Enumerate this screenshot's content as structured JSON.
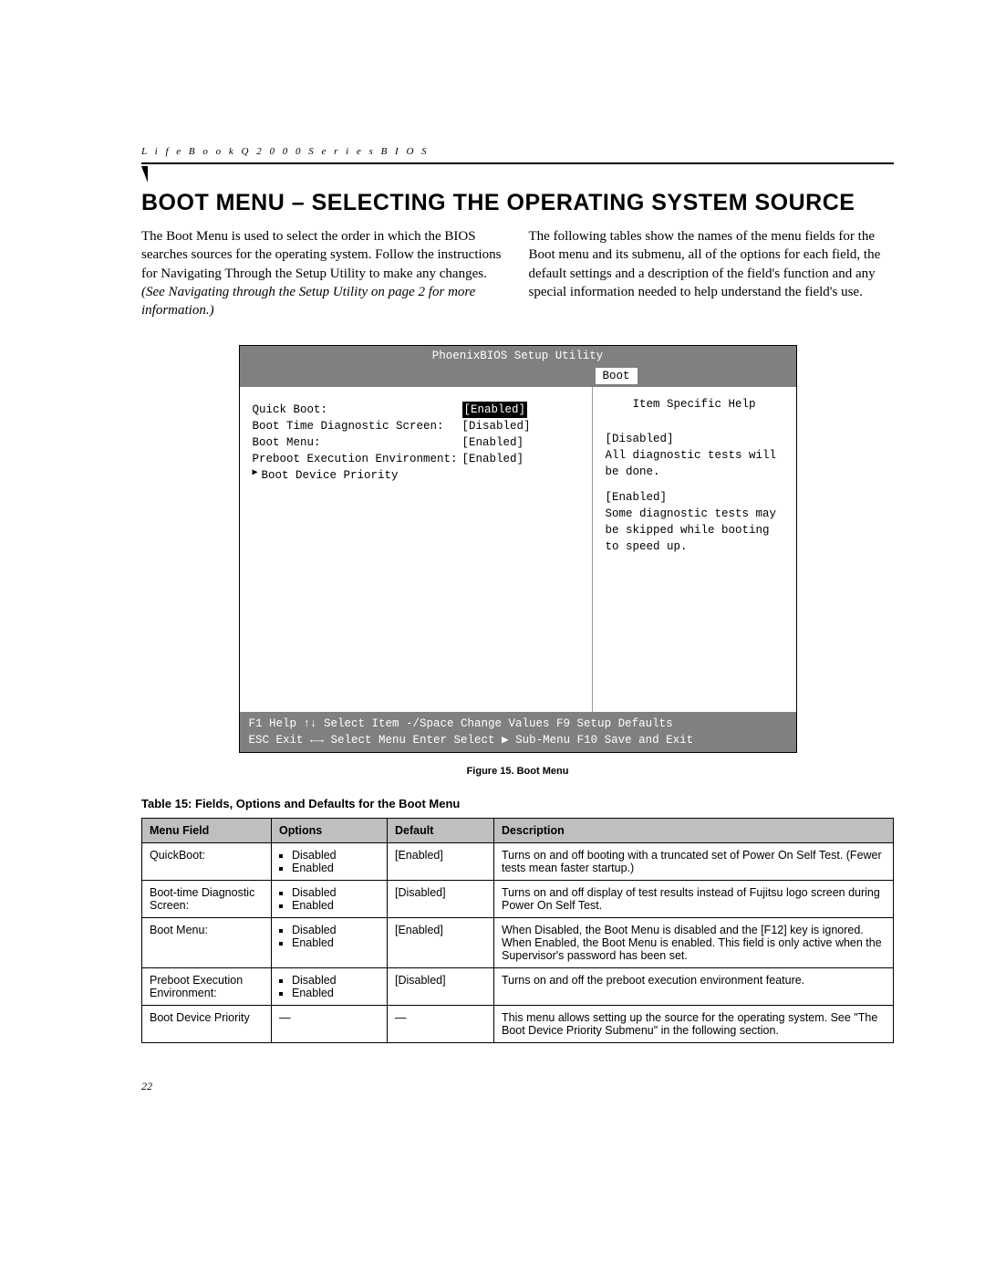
{
  "runningHead": "L i f e B o o k   Q 2 0 0 0   S e r i e s   B I O S",
  "heading": "BOOT MENU – SELECTING THE OPERATING SYSTEM SOURCE",
  "col1_a": "The Boot Menu is used to select the order in which the BIOS searches sources for the operating system. Follow the instructions for Navigating Through the Setup Utility to make any changes. ",
  "col1_b": "(See Navigating through the Setup Utility on page 2 for more information.)",
  "col2": "The following tables show the names of the menu fields for the Boot menu and its submenu, all of the options for each field, the default settings and a description of the field's function and any special information needed to help understand the field's use.",
  "bios": {
    "title": "PhoenixBIOS Setup Utility",
    "tab": "Boot",
    "rows": [
      {
        "label": "Quick Boot:",
        "value": "[Enabled]",
        "selected": true
      },
      {
        "label": "Boot Time Diagnostic Screen:",
        "value": "[Disabled]",
        "selected": false
      },
      {
        "label": "Boot Menu:",
        "value": "[Enabled]",
        "selected": false
      },
      {
        "label": "Preboot Execution Environment:",
        "value": "[Enabled]",
        "selected": false
      }
    ],
    "submenu": "Boot Device Priority",
    "helpTitle": "Item Specific Help",
    "help1": "[Disabled]",
    "help1b": "All diagnostic tests will be done.",
    "help2": "[Enabled]",
    "help2b": "Some diagnostic tests may be skipped while booting to speed up.",
    "footer": {
      "l1": "F1  Help    ↑↓ Select Item  -/Space  Change Values       F9   Setup Defaults",
      "l2": "ESC Exit    ←→ Select Menu  Enter    Select ▶ Sub-Menu   F10  Save and Exit"
    }
  },
  "figCaption": "Figure 15.  Boot Menu",
  "tableCaption": "Table 15: Fields, Options and Defaults for the Boot Menu",
  "th": {
    "c1": "Menu Field",
    "c2": "Options",
    "c3": "Default",
    "c4": "Description"
  },
  "rows": [
    {
      "field": "QuickBoot:",
      "opt1": "Disabled",
      "opt2": "Enabled",
      "def": "[Enabled]",
      "desc": "Turns on and off booting with a truncated set of Power On Self Test. (Fewer tests mean faster startup.)"
    },
    {
      "field": "Boot-time Diagnostic Screen:",
      "opt1": "Disabled",
      "opt2": "Enabled",
      "def": "[Disabled]",
      "desc": "Turns on and off display of test results instead of Fujitsu logo screen during Power On Self Test."
    },
    {
      "field": "Boot Menu:",
      "opt1": "Disabled",
      "opt2": "Enabled",
      "def": "[Enabled]",
      "desc": "When Disabled, the Boot Menu is disabled and the [F12] key is ignored. When Enabled, the Boot Menu is enabled. This field is only active when the Supervisor's password has been set."
    },
    {
      "field": "Preboot Execution Environment:",
      "opt1": "Disabled",
      "opt2": "Enabled",
      "def": "[Disabled]",
      "desc": "Turns on and off the preboot execution environment feature."
    },
    {
      "field": "Boot Device Priority",
      "opt1": "—",
      "opt2": "",
      "def": "—",
      "desc": "This menu allows setting up the source for the operating system. See \"The Boot Device Priority Submenu\" in the following section."
    }
  ],
  "pageNum": "22"
}
